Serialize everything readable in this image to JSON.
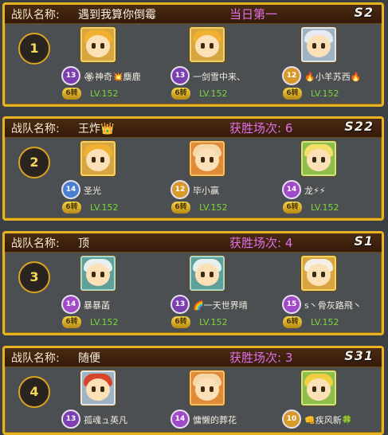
{
  "teams": [
    {
      "label": "战队名称:",
      "name": "遇到我算你倒霉",
      "status": "当日第一",
      "server": "S2",
      "rank": "1",
      "members": [
        {
          "badge": "13",
          "badge_color": "#7c3fb0",
          "name": "🏵神奇💥麋鹿",
          "turn": "6转",
          "level": "LV.152",
          "avatar": "gold"
        },
        {
          "badge": "13",
          "badge_color": "#7c3fb0",
          "name": "一剑雪中来、",
          "turn": "6转",
          "level": "LV.152",
          "avatar": "gold"
        },
        {
          "badge": "12",
          "badge_color": "#d79a2a",
          "name": "🔥小羊苏西🔥",
          "turn": "6转",
          "level": "LV.152",
          "avatar": "white"
        }
      ]
    },
    {
      "label": "战队名称:",
      "name": "王炸👑",
      "status": "获胜场次: 6",
      "server": "S22",
      "rank": "2",
      "members": [
        {
          "badge": "14",
          "badge_color": "#4a7fd0",
          "name": "圣光",
          "turn": "6转",
          "level": "LV.152",
          "avatar": "gold"
        },
        {
          "badge": "12",
          "badge_color": "#d79a2a",
          "name": "毕小赢",
          "turn": "6转",
          "level": "LV.152",
          "avatar": "orange"
        },
        {
          "badge": "14",
          "badge_color": "#a04ac8",
          "name": "龙⚡⚡",
          "turn": "6转",
          "level": "LV.152",
          "avatar": "green"
        }
      ]
    },
    {
      "label": "战队名称:",
      "name": "顶",
      "status": "获胜场次: 4",
      "server": "S1",
      "rank": "3",
      "members": [
        {
          "badge": "14",
          "badge_color": "#a04ac8",
          "name": "暴暴菡",
          "turn": "6转",
          "level": "LV.152",
          "avatar": "teal"
        },
        {
          "badge": "13",
          "badge_color": "#7c3fb0",
          "name": "🌈一天世界晴",
          "turn": "6转",
          "level": "LV.152",
          "avatar": "teal"
        },
        {
          "badge": "15",
          "badge_color": "#a04ac8",
          "name": "s丶骨灰路飛丶",
          "turn": "6转",
          "level": "LV.152",
          "avatar": "gold"
        }
      ]
    },
    {
      "label": "战队名称:",
      "name": "随便",
      "status": "获胜场次: 3",
      "server": "S31",
      "rank": "4",
      "members": [
        {
          "badge": "13",
          "badge_color": "#7c3fb0",
          "name": "孤魂ュ英凡",
          "turn": "",
          "level": "",
          "avatar": "white"
        },
        {
          "badge": "14",
          "badge_color": "#a04ac8",
          "name": "慵懒的葬花",
          "turn": "",
          "level": "",
          "avatar": "orange"
        },
        {
          "badge": "10",
          "badge_color": "#d79a2a",
          "name": "👊疾风新🍀",
          "turn": "",
          "level": "",
          "avatar": "gold"
        }
      ]
    }
  ]
}
